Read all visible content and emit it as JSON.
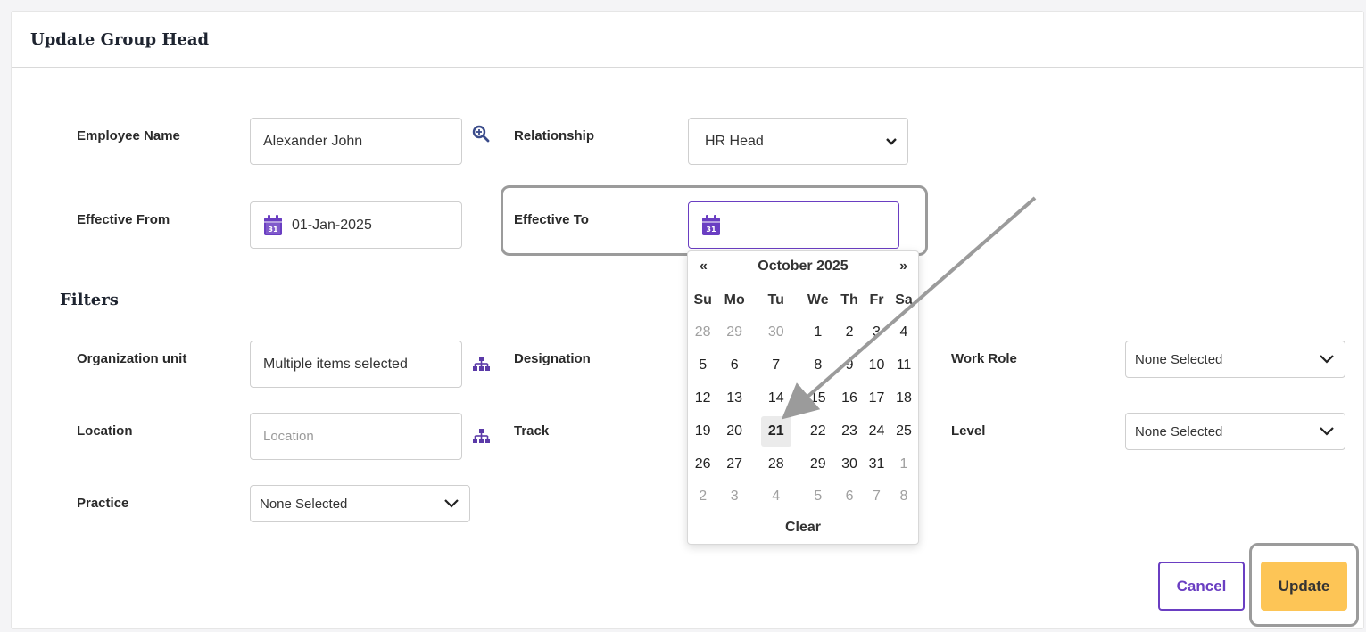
{
  "card": {
    "title": "Update Group Head"
  },
  "form": {
    "employee_name": {
      "label": "Employee Name",
      "value": "Alexander John"
    },
    "relationship": {
      "label": "Relationship",
      "value": "HR Head"
    },
    "effective_from": {
      "label": "Effective From",
      "value": "01-Jan-2025"
    },
    "effective_to": {
      "label": "Effective To",
      "value": ""
    }
  },
  "filters": {
    "title": "Filters",
    "organization_unit": {
      "label": "Organization unit",
      "value": "Multiple items selected"
    },
    "designation": {
      "label": "Designation"
    },
    "work_role": {
      "label": "Work Role",
      "value": "None Selected"
    },
    "location": {
      "label": "Location",
      "placeholder": "Location"
    },
    "track": {
      "label": "Track"
    },
    "level": {
      "label": "Level",
      "value": "None Selected"
    },
    "practice": {
      "label": "Practice",
      "value": "None Selected"
    }
  },
  "datepicker": {
    "prev": "«",
    "next": "»",
    "month": "October 2025",
    "weekdays": [
      "Su",
      "Mo",
      "Tu",
      "We",
      "Th",
      "Fr",
      "Sa"
    ],
    "weeks": [
      [
        "28",
        "29",
        "30",
        "1",
        "2",
        "3",
        "4"
      ],
      [
        "5",
        "6",
        "7",
        "8",
        "9",
        "10",
        "11"
      ],
      [
        "12",
        "13",
        "14",
        "15",
        "16",
        "17",
        "18"
      ],
      [
        "19",
        "20",
        "21",
        "22",
        "23",
        "24",
        "25"
      ],
      [
        "26",
        "27",
        "28",
        "29",
        "30",
        "31",
        "1"
      ],
      [
        "2",
        "3",
        "4",
        "5",
        "6",
        "7",
        "8"
      ]
    ],
    "highlighted_day": "21",
    "clear_label": "Clear"
  },
  "actions": {
    "cancel_label": "Cancel",
    "update_label": "Update"
  },
  "colors": {
    "accent": "#6a3ec2",
    "update": "#fdc556",
    "icon": "#5b3aa8"
  }
}
